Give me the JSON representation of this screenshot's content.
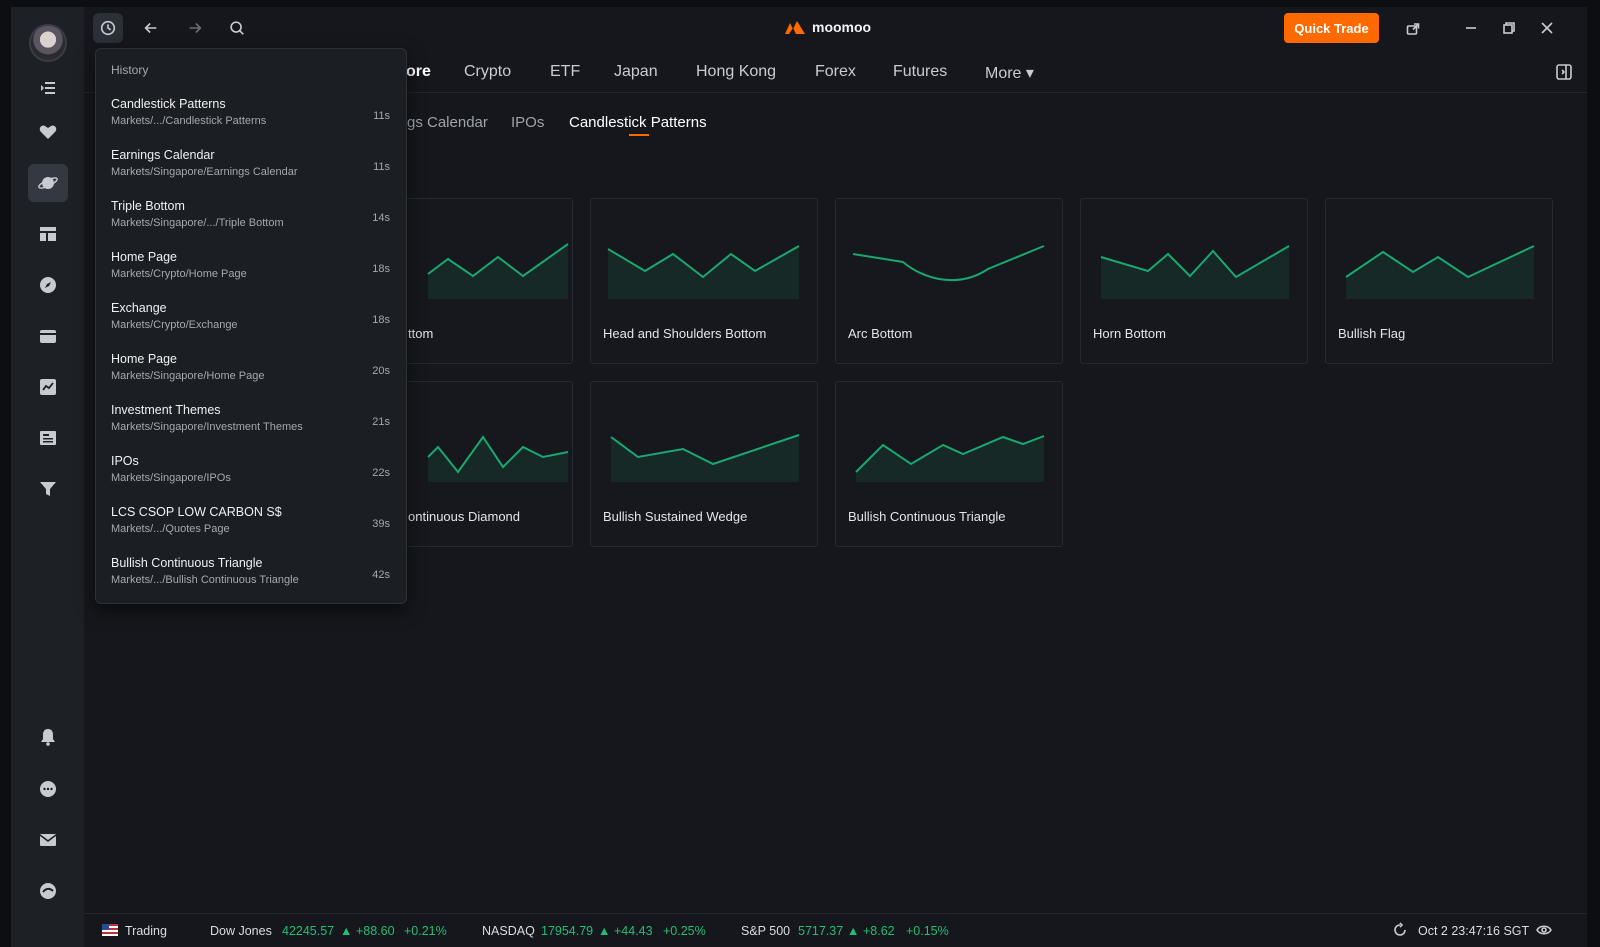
{
  "app": {
    "logo_text": "moomoo",
    "quick_trade": "Quick Trade"
  },
  "market_tabs": [
    "ore",
    "Crypto",
    "ETF",
    "Japan",
    "Hong Kong",
    "Forex",
    "Futures",
    "More ▾"
  ],
  "sub_tabs": [
    "gs Calendar",
    "IPOs",
    "Candlestick Patterns"
  ],
  "cards": [
    {
      "label": "ttom"
    },
    {
      "label": "Head and Shoulders Bottom"
    },
    {
      "label": "Arc Bottom"
    },
    {
      "label": "Horn Bottom"
    },
    {
      "label": "Bullish Flag"
    },
    {
      "label": "ontinuous Diamond"
    },
    {
      "label": "Bullish Sustained Wedge"
    },
    {
      "label": "Bullish Continuous Triangle"
    }
  ],
  "history": {
    "title": "History",
    "items": [
      {
        "title": "Candlestick Patterns",
        "path": "Markets/.../Candlestick Patterns",
        "time": "11s"
      },
      {
        "title": "Earnings Calendar",
        "path": "Markets/Singapore/Earnings Calendar",
        "time": "11s"
      },
      {
        "title": "Triple Bottom",
        "path": "Markets/Singapore/.../Triple Bottom",
        "time": "14s"
      },
      {
        "title": "Home Page",
        "path": "Markets/Crypto/Home Page",
        "time": "18s"
      },
      {
        "title": "Exchange",
        "path": "Markets/Crypto/Exchange",
        "time": "18s"
      },
      {
        "title": "Home Page",
        "path": "Markets/Singapore/Home Page",
        "time": "20s"
      },
      {
        "title": "Investment Themes",
        "path": "Markets/Singapore/Investment Themes",
        "time": "21s"
      },
      {
        "title": "IPOs",
        "path": "Markets/Singapore/IPOs",
        "time": "22s"
      },
      {
        "title": "LCS CSOP LOW CARBON S$",
        "path": "Markets/.../Quotes Page",
        "time": "39s"
      },
      {
        "title": "Bullish Continuous Triangle",
        "path": "Markets/.../Bullish Continuous Triangle",
        "time": "42s"
      }
    ]
  },
  "status": {
    "trading": "Trading",
    "dow_label": "Dow Jones",
    "dow_value": "42245.57",
    "dow_change": "+88.60",
    "dow_pct": "+0.21%",
    "nasdaq_label": "NASDAQ",
    "nasdaq_value": "17954.79",
    "nasdaq_change": "+44.43",
    "nasdaq_pct": "+0.25%",
    "sp_label": "S&P 500",
    "sp_value": "5717.37",
    "sp_change": "+8.62",
    "sp_pct": "+0.15%",
    "datetime": "Oct 2 23:47:16 SGT"
  },
  "colors": {
    "accent": "#ff6a00",
    "up": "#1fbf75",
    "line": "#1aa870"
  },
  "icons": [
    "history-icon",
    "back-arrow-icon",
    "forward-arrow-icon",
    "search-icon",
    "share-icon",
    "minimize-icon",
    "restore-icon",
    "close-icon",
    "expand-panel-icon",
    "menu-indent-icon",
    "heart-icon",
    "planet-icon",
    "layout-icon",
    "compass-icon",
    "wallet-icon",
    "chart-icon",
    "news-icon",
    "filter-icon",
    "bell-icon",
    "chat-icon",
    "mail-icon",
    "moomoo-icon"
  ]
}
